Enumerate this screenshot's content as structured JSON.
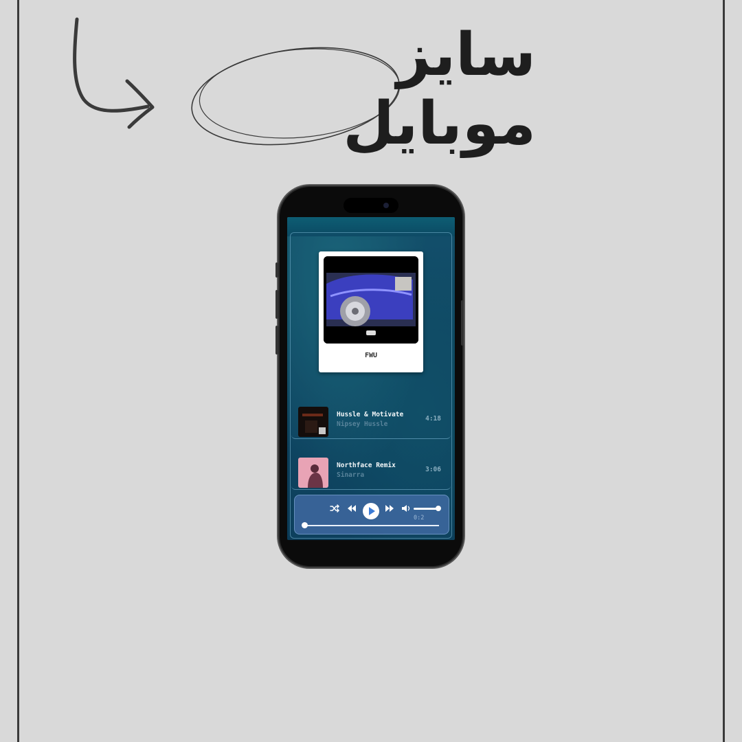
{
  "header": {
    "title": "سايز موبايل"
  },
  "now_playing": {
    "title": "FWU",
    "art_label": "FWU"
  },
  "tracks": [
    {
      "title": "Hussle & Motivate",
      "artist": "Nipsey Hussle",
      "duration": "4:18"
    },
    {
      "title": "Northface Remix",
      "artist": "Sinarra",
      "duration": "3:06"
    }
  ],
  "player": {
    "time": "0:2",
    "progress": 0.0,
    "volume": 1.0,
    "icons": [
      "shuffle-icon",
      "previous-icon",
      "play-icon",
      "next-icon",
      "volume-icon"
    ]
  },
  "colors": {
    "background": "#d9d9d9",
    "title": "#1e1e1e",
    "player": "#466eaa",
    "accent_blue": "#3b7bd6"
  }
}
